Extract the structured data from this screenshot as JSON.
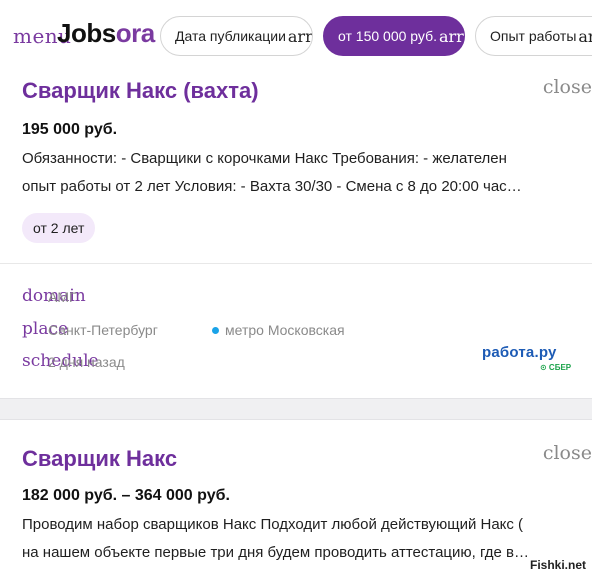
{
  "header": {
    "menu_icon_text": "menu",
    "logo_part1": "Jobs",
    "logo_part2": "ora",
    "filters": [
      {
        "label": "Дата публикации",
        "icon_text": "arrow"
      },
      {
        "label": "от 150 000 руб.",
        "icon_text": "arrow"
      },
      {
        "label": "Опыт работы",
        "icon_text": "arrow"
      }
    ]
  },
  "jobs": [
    {
      "title": "Сварщик Накс (вахта)",
      "close_icon_text": "close",
      "salary": "195 000 руб.",
      "description_lines": [
        "Обязанности: - Сварщики с корочками Накс Требования: - желателен",
        "опыт работы от 2 лет Условия: - Вахта 30/30 - Смена с 8 до 20:00 час…"
      ],
      "badge": "от 2 лет",
      "meta": {
        "company_icon_text": "domain",
        "company": "АМГ",
        "location_icon_text": "place",
        "city": "Санкт-Петербург",
        "metro": "метро Московская",
        "time_icon_text": "schedule",
        "posted": "2 дня назад"
      },
      "source": {
        "name": "работа.ру",
        "sub": "⊙ СБЕР"
      }
    },
    {
      "title": "Сварщик Накс",
      "close_icon_text": "close",
      "salary": "182 000 руб. – 364 000 руб.",
      "description_lines": [
        "Проводим набор сварщиков Накс Подходит любой действующий Накс (",
        "на нашем объекте первые три дня будем проводить аттестацию, где в…"
      ]
    }
  ],
  "watermark": "Fishki.net",
  "colors": {
    "accent": "#6e2f9c",
    "metro_dot": "#1aa3e8",
    "source_blue": "#1d5bb5",
    "sber_green": "#1aa34a"
  }
}
